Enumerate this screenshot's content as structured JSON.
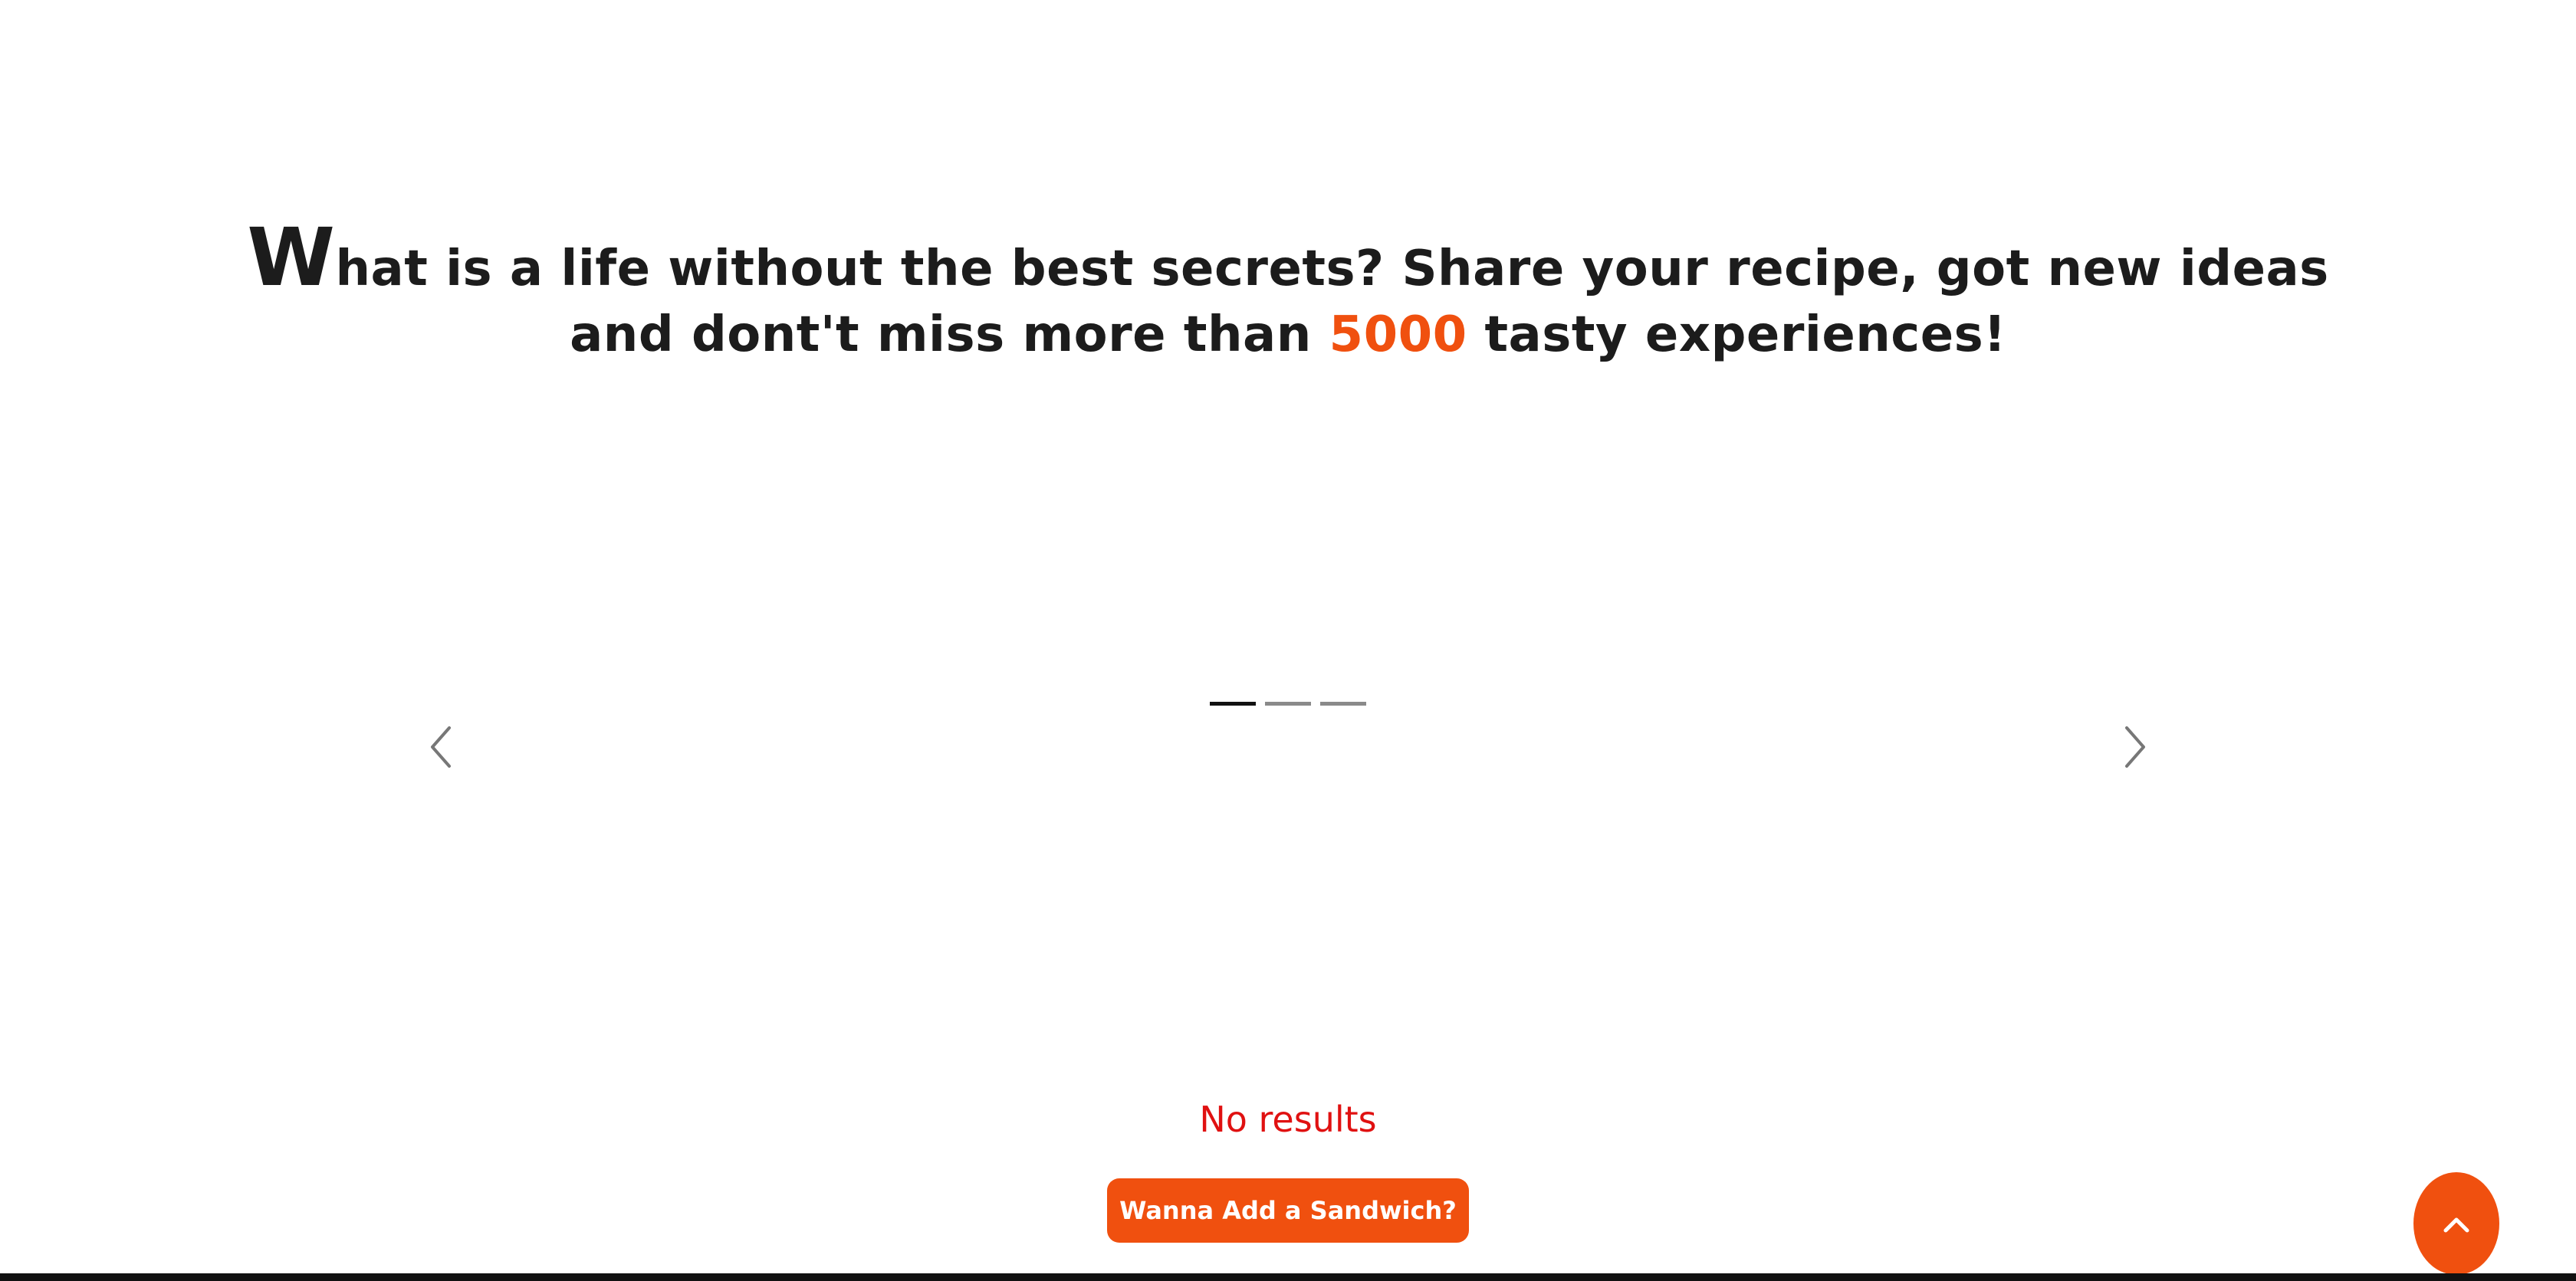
{
  "hero": {
    "dropcap": "W",
    "line1_rest": "hat is a life without the best secrets? Share your recipe, got new ideas",
    "line2_before": "and dont't miss more than ",
    "highlight_number": "5000",
    "line2_after": " tasty experiences!"
  },
  "carousel": {
    "indicator_count": 3,
    "active_index": 0,
    "prev_icon": "chevron-left-icon",
    "next_icon": "chevron-right-icon"
  },
  "results": {
    "message": "No results"
  },
  "actions": {
    "add_sandwich_label": "Wanna Add a Sandwich?",
    "scroll_top_icon": "chevron-up-icon"
  },
  "colors": {
    "accent": "#f0500f",
    "error": "#e01111",
    "text": "#1c1c1c"
  }
}
